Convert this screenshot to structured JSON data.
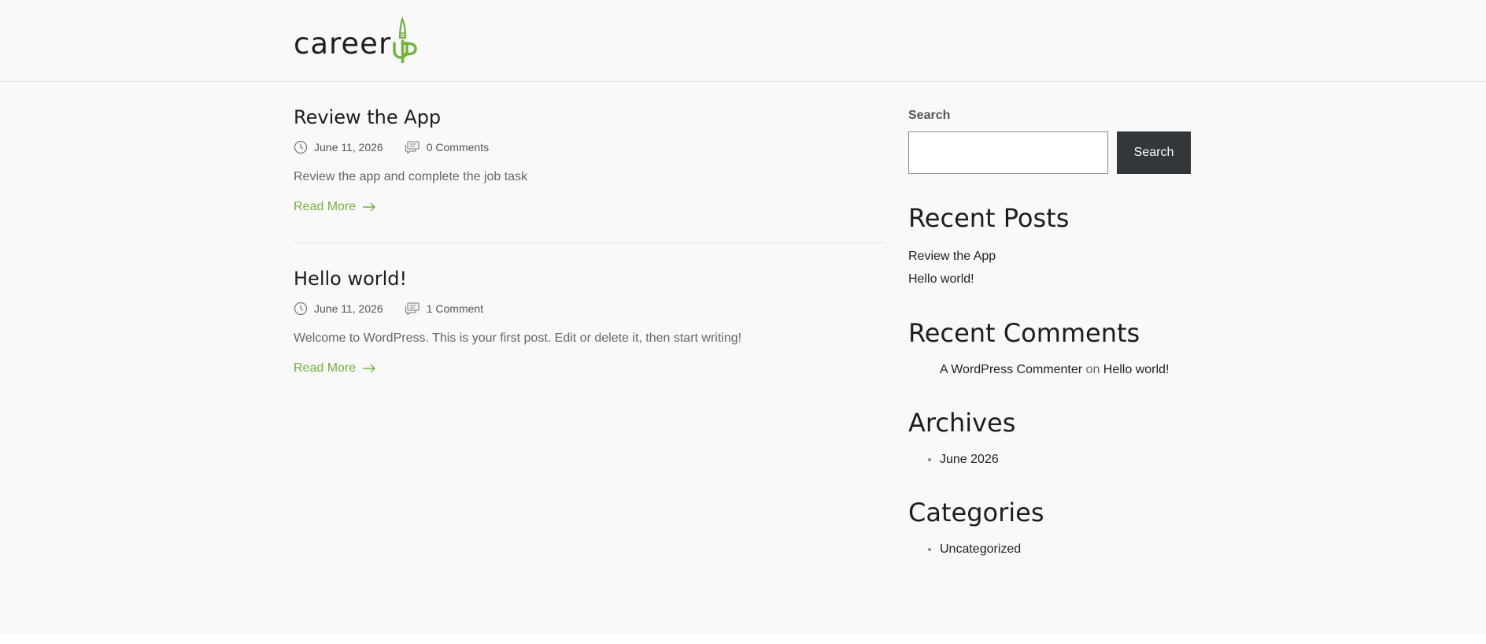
{
  "header": {
    "logo_text": "career",
    "logo_accent_text": "up",
    "brand_color": "#72b23f"
  },
  "posts": [
    {
      "title": "Review the App",
      "date": "June 11, 2026",
      "comments": "0 Comments",
      "excerpt": "Review the app and complete the job task",
      "read_more": "Read More"
    },
    {
      "title": "Hello world!",
      "date": "June 11, 2026",
      "comments": "1 Comment",
      "excerpt": "Welcome to WordPress. This is your first post. Edit or delete it, then start writing!",
      "read_more": "Read More"
    }
  ],
  "sidebar": {
    "search": {
      "label": "Search",
      "placeholder": "",
      "button_label": "Search"
    },
    "recent_posts": {
      "heading": "Recent Posts",
      "items": [
        "Review the App",
        "Hello world!"
      ]
    },
    "recent_comments": {
      "heading": "Recent Comments",
      "author": "A WordPress Commenter",
      "on_text": "on",
      "post": "Hello world!"
    },
    "archives": {
      "heading": "Archives",
      "items": [
        "June 2026"
      ]
    },
    "categories": {
      "heading": "Categories",
      "items": [
        "Uncategorized"
      ]
    }
  }
}
